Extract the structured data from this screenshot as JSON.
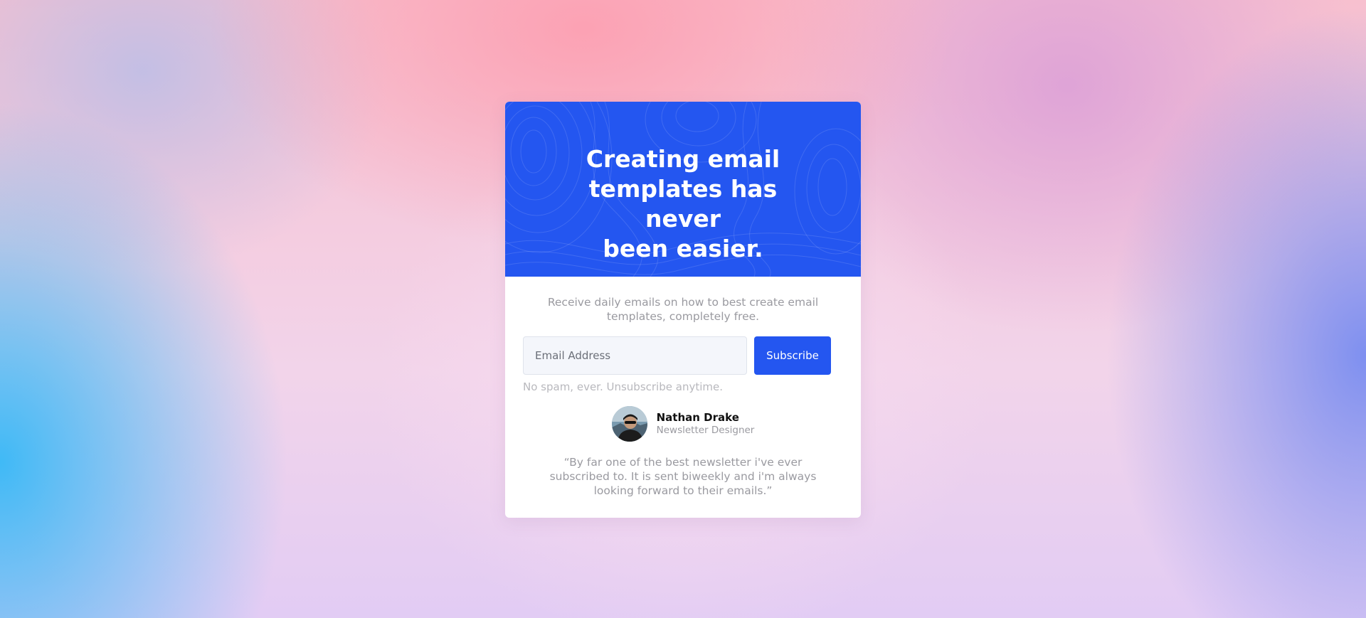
{
  "hero": {
    "title": "Creating email\ntemplates has never\nbeen easier.",
    "background_color": "#2456f0"
  },
  "intro": {
    "text": "Receive daily emails on how to best create email\ntemplates, completely free."
  },
  "signup": {
    "email_placeholder": "Email Address",
    "email_value": "",
    "subscribe_label": "Subscribe",
    "note": "No spam, ever. Unsubscribe anytime."
  },
  "testimonial": {
    "author_name": "Nathan Drake",
    "author_role": "Newsletter Designer",
    "quote": "“By far one of the best newsletter i've ever\nsubscribed to. It is sent biweekly and i'm always\nlooking forward to their emails.”"
  },
  "colors": {
    "accent": "#2456f0",
    "muted_text": "#9a9aa0",
    "input_background": "#f4f6fb"
  }
}
